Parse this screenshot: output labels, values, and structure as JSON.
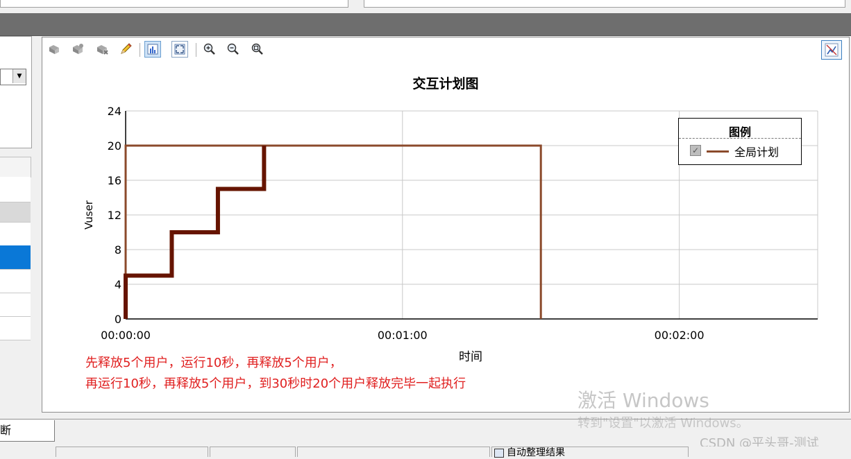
{
  "chart_panel": {
    "title": "交互计划图",
    "legend": {
      "title": "图例",
      "items": [
        {
          "label": "全局计划",
          "checked": true,
          "color": "#8b4a2b"
        }
      ]
    },
    "annotations": [
      "先释放5个用户，运行10秒，再释放5个用户，",
      "再运行10秒，再释放5个用户，到30秒时20个用户释放完毕一起执行"
    ],
    "toolbar_icons": [
      "open-icon",
      "save-icon",
      "print-icon",
      "pencil-icon",
      "chart-view-icon",
      "fit-icon",
      "zoom-in-icon",
      "zoom-out-icon",
      "zoom-reset-icon"
    ],
    "corner_icon": "chart-toggle-icon"
  },
  "chart_data": {
    "type": "line",
    "title": "交互计划图",
    "xlabel": "时间",
    "ylabel": "Vuser",
    "xlim": [
      0,
      150
    ],
    "ylim": [
      0,
      24
    ],
    "x_ticks": [
      {
        "value": 0,
        "label": "00:00:00"
      },
      {
        "value": 60,
        "label": "00:01:00"
      },
      {
        "value": 120,
        "label": "00:02:00"
      }
    ],
    "y_ticks": [
      0,
      4,
      8,
      12,
      16,
      20,
      24
    ],
    "grid": true,
    "legend_position": "top-right",
    "series": [
      {
        "name": "全局计划",
        "color": "#8b4a2b",
        "points": [
          [
            0,
            0
          ],
          [
            0,
            20
          ],
          [
            90,
            20
          ],
          [
            90,
            0
          ]
        ]
      }
    ],
    "highlighted_rampup": {
      "color": "#661400",
      "points": [
        [
          0,
          0
        ],
        [
          0,
          5
        ],
        [
          10,
          5
        ],
        [
          10,
          10
        ],
        [
          20,
          10
        ],
        [
          20,
          15
        ],
        [
          30,
          15
        ],
        [
          30,
          20
        ]
      ]
    }
  },
  "watermark": {
    "line1": "激活 Windows",
    "line2": "转到\"设置\"以激活 Windows。"
  },
  "csdn": "CSDN @平头哥-测试",
  "bottom": {
    "tab_label": "断",
    "status_text": "自动整理结果"
  }
}
